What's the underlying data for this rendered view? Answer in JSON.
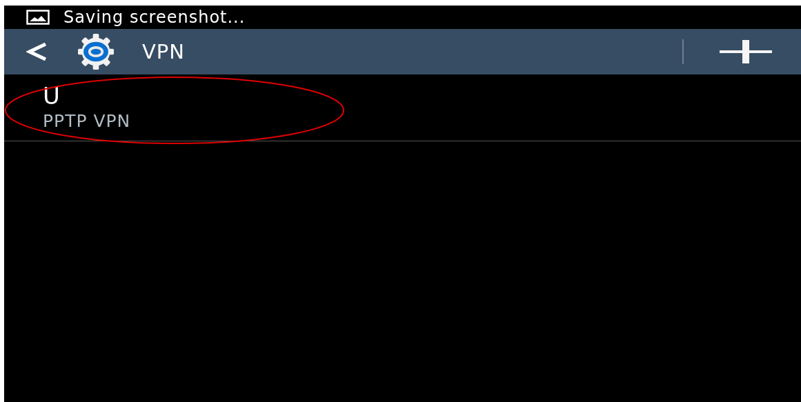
{
  "status_bar": {
    "notification": "Saving screenshot..."
  },
  "action_bar": {
    "title": "VPN"
  },
  "vpn_list": [
    {
      "name": "U",
      "type": "PPTP VPN",
      "highlighted": true
    }
  ]
}
